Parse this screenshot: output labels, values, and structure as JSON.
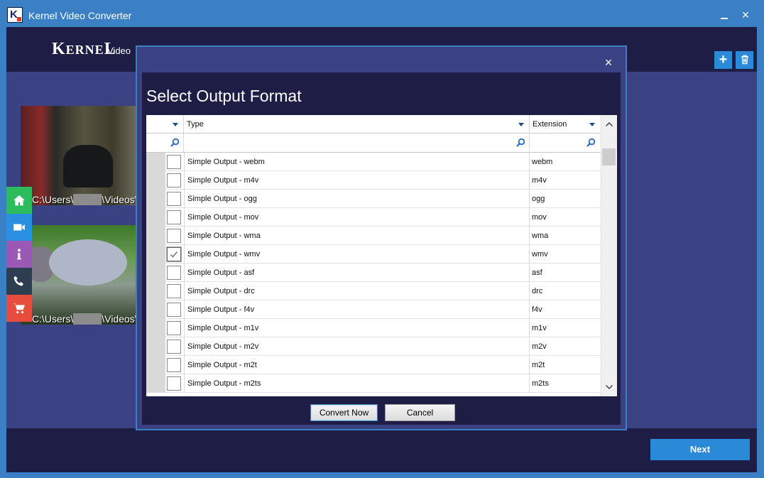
{
  "window": {
    "title": "Kernel Video Converter",
    "app_icon_letter": "K",
    "minimize_icon": "minimize-icon",
    "close_icon": "×"
  },
  "header": {
    "brand": "Kernel",
    "brand_sub": "Video",
    "add_label": "+",
    "delete_icon": "trash-icon"
  },
  "videos": [
    {
      "path_prefix": "C:\\Users\\",
      "path_suffix": "\\Videos\\"
    },
    {
      "path_prefix": "C:\\Users\\",
      "path_suffix": "\\Videos\\"
    }
  ],
  "side_nav": [
    {
      "icon": "home-icon",
      "color": "#2ebb5e"
    },
    {
      "icon": "video-camera-icon",
      "color": "#2a8fe0"
    },
    {
      "icon": "info-icon",
      "color": "#9b59b6"
    },
    {
      "icon": "phone-icon",
      "color": "#2c3e50"
    },
    {
      "icon": "cart-icon",
      "color": "#e74c3c"
    }
  ],
  "footer": {
    "next_label": "Next"
  },
  "modal": {
    "title": "Select Output Format",
    "close_icon": "×",
    "columns": {
      "type": "Type",
      "extension": "Extension"
    },
    "rows": [
      {
        "type": "Simple Output - webm",
        "ext": "webm",
        "checked": false
      },
      {
        "type": "Simple Output - m4v",
        "ext": "m4v",
        "checked": false
      },
      {
        "type": "Simple Output - ogg",
        "ext": "ogg",
        "checked": false
      },
      {
        "type": "Simple Output - mov",
        "ext": "mov",
        "checked": false
      },
      {
        "type": "Simple Output - wma",
        "ext": "wma",
        "checked": false
      },
      {
        "type": "Simple Output - wmv",
        "ext": "wmv",
        "checked": true
      },
      {
        "type": "Simple Output - asf",
        "ext": "asf",
        "checked": false
      },
      {
        "type": "Simple Output - drc",
        "ext": "drc",
        "checked": false
      },
      {
        "type": "Simple Output - f4v",
        "ext": "f4v",
        "checked": false
      },
      {
        "type": "Simple Output - m1v",
        "ext": "m1v",
        "checked": false
      },
      {
        "type": "Simple Output - m2v",
        "ext": "m2v",
        "checked": false
      },
      {
        "type": "Simple Output - m2t",
        "ext": "m2t",
        "checked": false
      },
      {
        "type": "Simple Output - m2ts",
        "ext": "m2ts",
        "checked": false
      }
    ],
    "convert_label": "Convert Now",
    "cancel_label": "Cancel"
  },
  "colors": {
    "title_bar": "#3b7fc4",
    "app_bg": "#3a4284",
    "header_bg": "#1d1d45",
    "accent": "#2b8ad8"
  }
}
